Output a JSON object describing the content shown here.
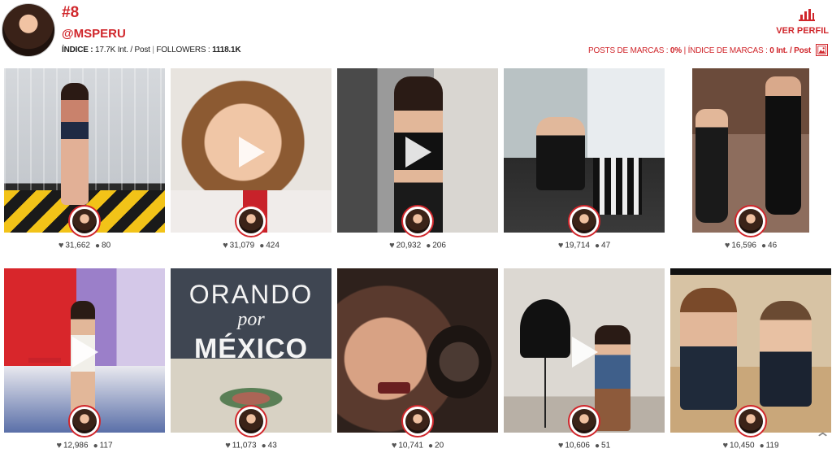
{
  "profile": {
    "rank": "#8",
    "handle": "@MSPERU",
    "index_label": "ÍNDICE :",
    "index_value": "17.7K Int. / Post",
    "followers_label": "FOLLOWERS :",
    "followers_value": "1118.1K",
    "ver_perfil": "VER PERFIL",
    "brand_posts_label": "POSTS DE MARCAS :",
    "brand_posts_value": "0%",
    "brand_index_label": "ÍNDICE DE MARCAS :",
    "brand_index_value": "0 Int. / Post"
  },
  "icons": {
    "chart": "bar-chart-icon",
    "image": "image-icon",
    "heart": "heart-icon",
    "comment": "comment-icon",
    "scroll": "chevron-up-icon",
    "play": "play-icon"
  },
  "colors": {
    "accent": "#d0262b",
    "text": "#333333"
  },
  "posts": [
    {
      "likes": "31,662",
      "comments": "80",
      "video": false
    },
    {
      "likes": "31,079",
      "comments": "424",
      "video": true
    },
    {
      "likes": "20,932",
      "comments": "206",
      "video": true
    },
    {
      "likes": "19,714",
      "comments": "47",
      "video": false
    },
    {
      "likes": "16,596",
      "comments": "46",
      "video": false
    },
    {
      "likes": "12,986",
      "comments": "117",
      "video": true
    },
    {
      "likes": "11,073",
      "comments": "43",
      "video": false,
      "text_lines": [
        "ORANDO",
        "por",
        "MÉXICO"
      ]
    },
    {
      "likes": "10,741",
      "comments": "20",
      "video": false
    },
    {
      "likes": "10,606",
      "comments": "51",
      "video": true
    },
    {
      "likes": "10,450",
      "comments": "119",
      "video": false
    }
  ]
}
